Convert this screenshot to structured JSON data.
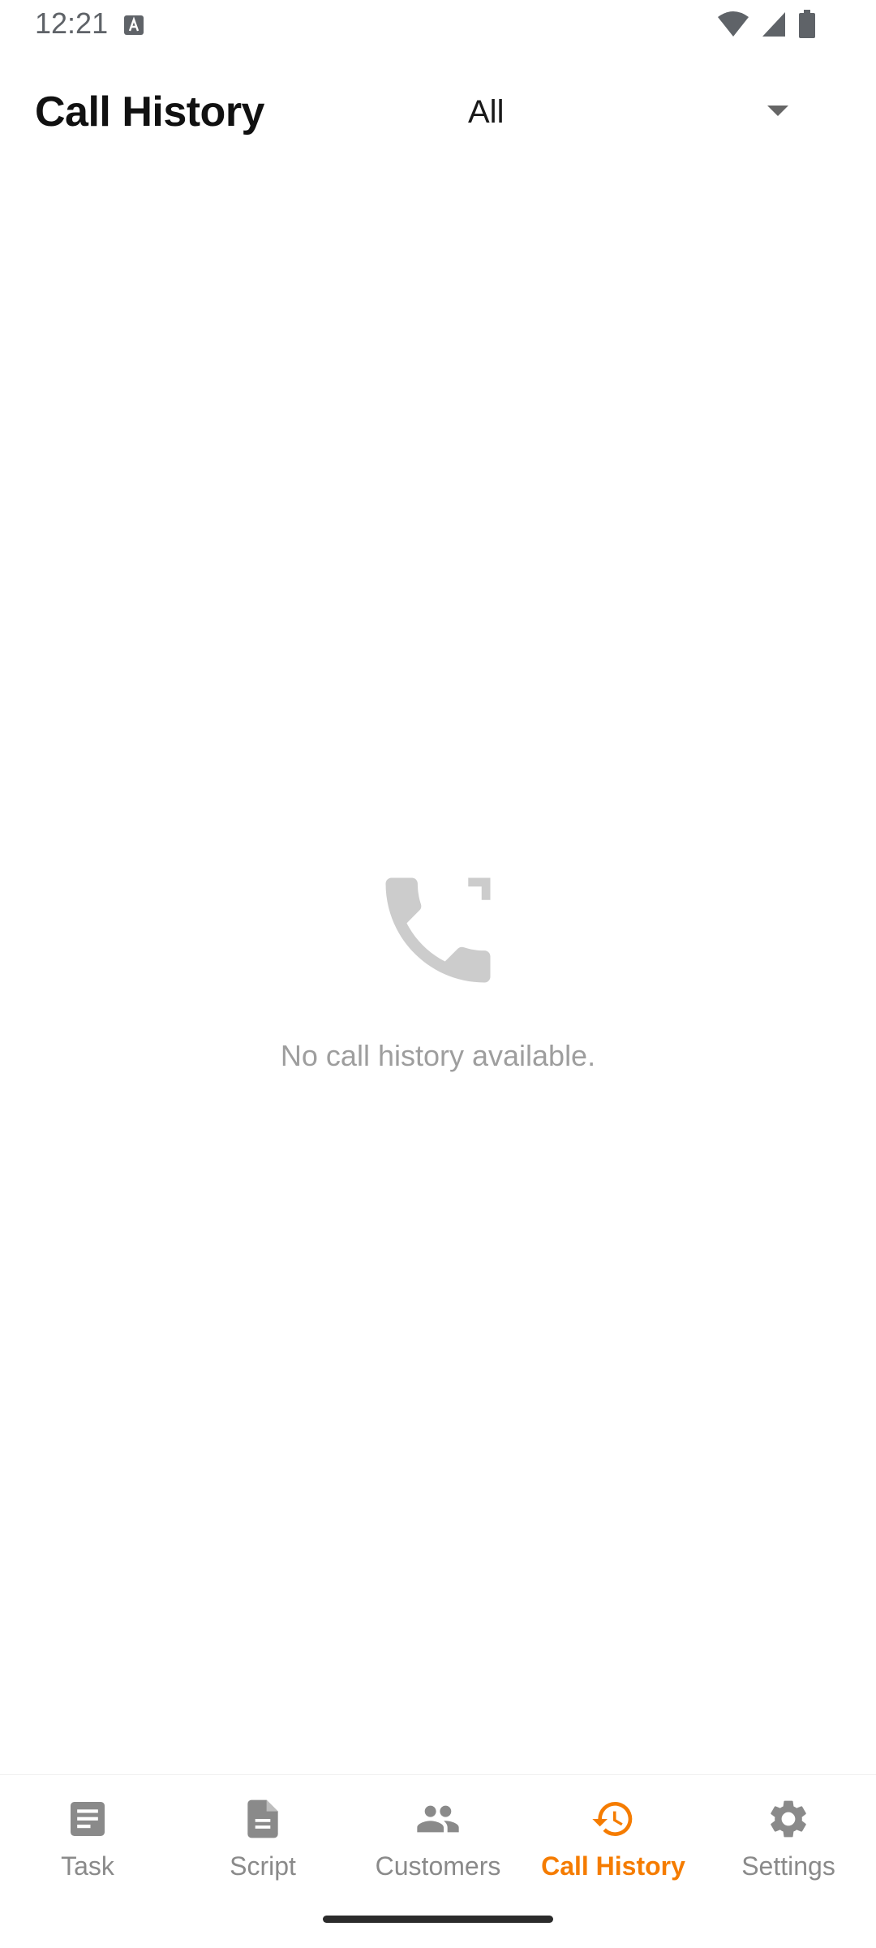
{
  "status_bar": {
    "time": "12:21",
    "notification_icon": "keyboard-a-icon",
    "icons": [
      "wifi-icon",
      "cell-signal-icon",
      "battery-icon"
    ]
  },
  "header": {
    "title": "Call History",
    "filter": {
      "selected": "All"
    }
  },
  "empty_state": {
    "icon": "phone-callback-icon",
    "message": "No call history available."
  },
  "bottom_nav": {
    "items": [
      {
        "label": "Task",
        "icon": "list-icon",
        "active": false
      },
      {
        "label": "Script",
        "icon": "document-icon",
        "active": false
      },
      {
        "label": "Customers",
        "icon": "people-icon",
        "active": false
      },
      {
        "label": "Call History",
        "icon": "history-icon",
        "active": true
      },
      {
        "label": "Settings",
        "icon": "gear-icon",
        "active": false
      }
    ]
  },
  "colors": {
    "accent": "#f57c00",
    "inactive": "#8a8a8a",
    "empty_icon": "#cccccc"
  }
}
